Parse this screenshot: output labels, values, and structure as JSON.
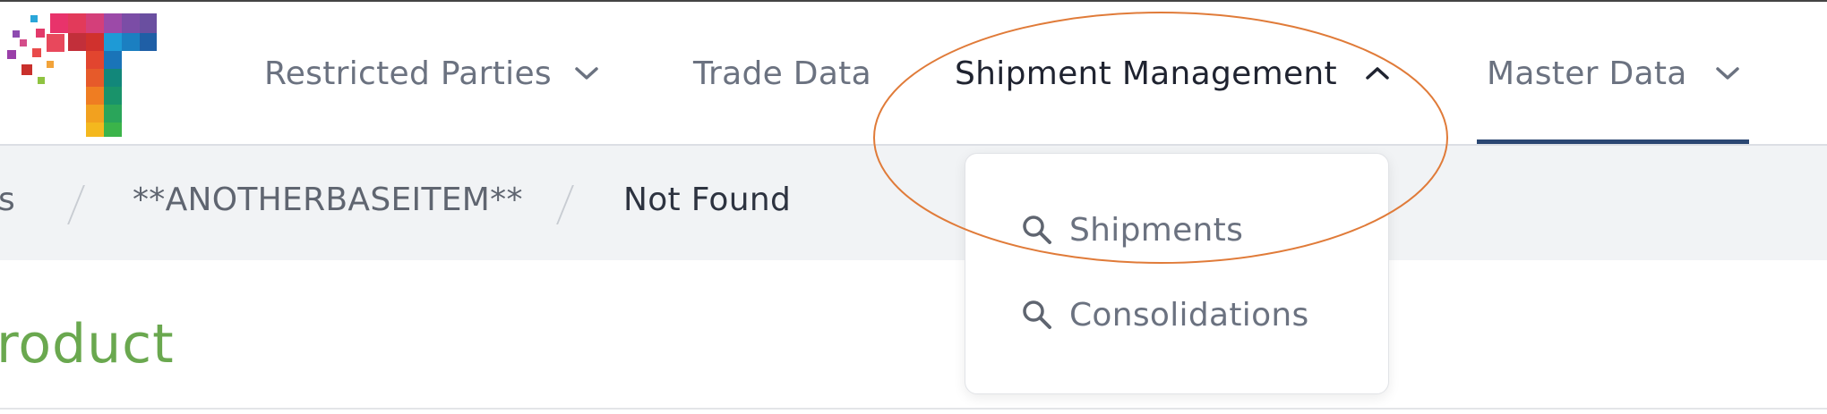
{
  "colors": {
    "nav_text": "#6b7280",
    "nav_active_text": "#1f2330",
    "nav_underline": "#2b4772",
    "breadcrumb_bg": "#f1f3f5",
    "title_green": "#6aa84f",
    "annotation_orange": "#e07b39"
  },
  "nav": {
    "items": [
      {
        "label": "Restricted Parties",
        "icon": "chevron-down-icon"
      },
      {
        "label": "Trade Data"
      },
      {
        "label": "Shipment Management",
        "icon": "chevron-up-icon"
      },
      {
        "label": "Master Data",
        "icon": "chevron-down-icon"
      }
    ]
  },
  "breadcrumb": {
    "items": [
      "s",
      "**ANOTHERBASEITEM**",
      "Not Found"
    ]
  },
  "dropdown": {
    "items": [
      {
        "label": "Shipments",
        "icon": "search-icon"
      },
      {
        "label": "Consolidations",
        "icon": "search-icon"
      }
    ]
  },
  "page": {
    "title": "roduct"
  }
}
